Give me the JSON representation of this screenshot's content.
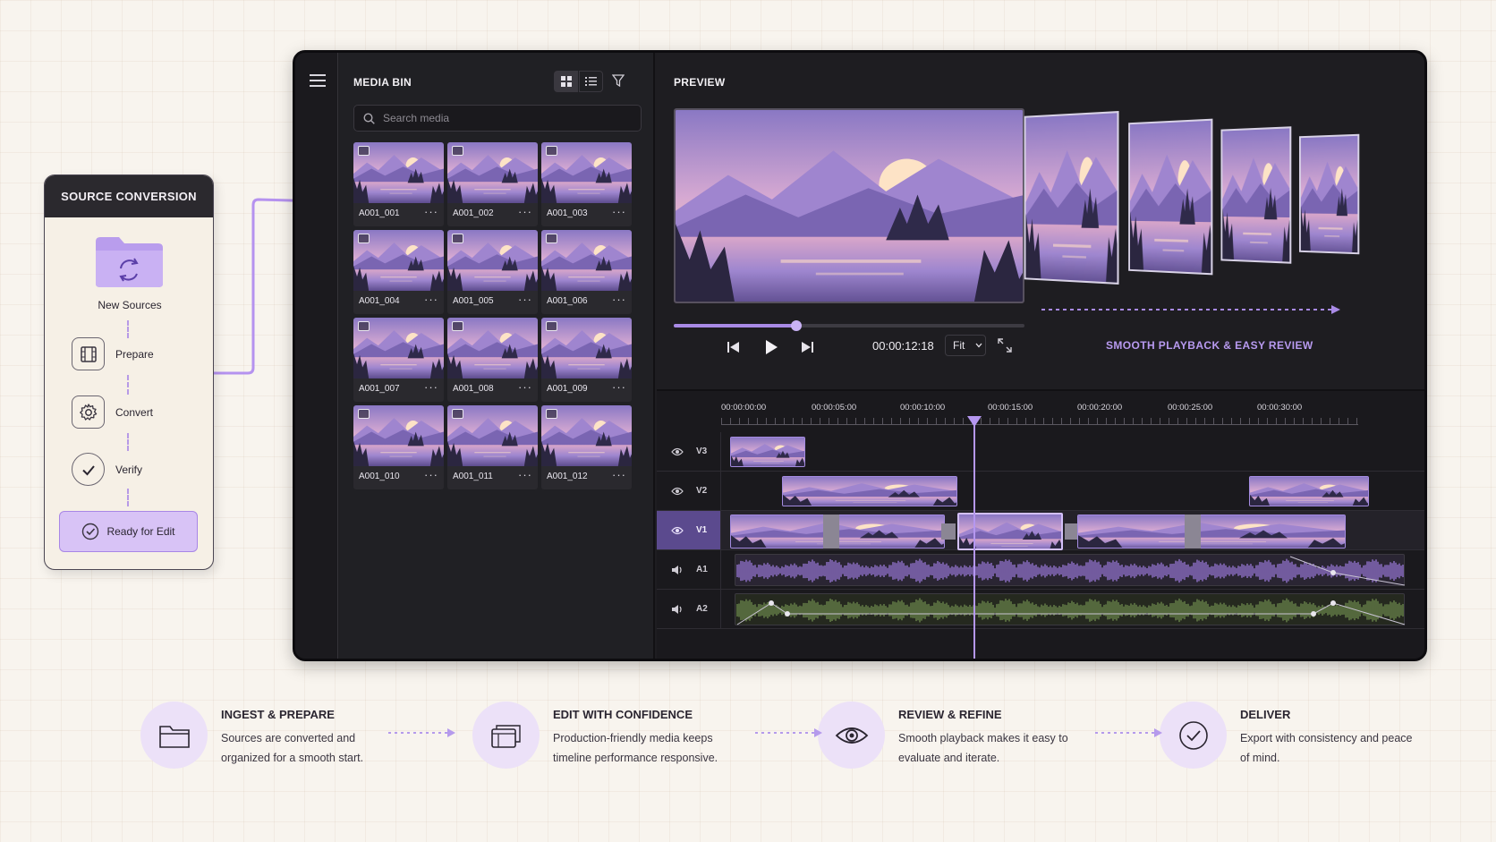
{
  "source_conversion": {
    "title": "SOURCE CONVERSION",
    "folder_label": "New Sources",
    "steps": [
      {
        "label": "Prepare",
        "icon": "film-icon"
      },
      {
        "label": "Convert",
        "icon": "gear-icon"
      },
      {
        "label": "Verify",
        "icon": "check-icon"
      }
    ],
    "ready_button": "Ready for Edit"
  },
  "media_bin": {
    "title": "MEDIA BIN",
    "search_placeholder": "Search media",
    "clips": [
      "A001_001",
      "A001_002",
      "A001_003",
      "A001_004",
      "A001_005",
      "A001_006",
      "A001_007",
      "A001_008",
      "A001_009",
      "A001_010",
      "A001_011",
      "A001_012"
    ]
  },
  "preview": {
    "title": "PREVIEW",
    "timecode": "00:00:12:18",
    "zoom": "Fit",
    "progress_fraction": 0.35,
    "tagline": "SMOOTH PLAYBACK & EASY REVIEW"
  },
  "timeline": {
    "ruler": [
      "00:00:00:00",
      "00:00:05:00",
      "00:00:10:00",
      "00:00:15:00",
      "00:00:20:00",
      "00:00:25:00",
      "00:00:30:00"
    ],
    "tracks": [
      "V3",
      "V2",
      "V1",
      "A1",
      "A2"
    ],
    "playhead": "00:00:12:18"
  },
  "features": [
    {
      "title": "INGEST & PREPARE",
      "desc": "Sources are converted and organized for a smooth start.",
      "icon": "folder-icon"
    },
    {
      "title": "EDIT WITH CONFIDENCE",
      "desc": "Production-friendly media keeps timeline performance responsive.",
      "icon": "media-stack-icon"
    },
    {
      "title": "REVIEW & REFINE",
      "desc": "Smooth playback makes it easy to evaluate and iterate.",
      "icon": "eye-icon"
    },
    {
      "title": "DELIVER",
      "desc": "Export with consistency and peace of mind.",
      "icon": "check-circle-icon"
    }
  ],
  "colors": {
    "accent": "#b89af0",
    "panel": "#1e1d21",
    "page": "#f8f4ee"
  }
}
